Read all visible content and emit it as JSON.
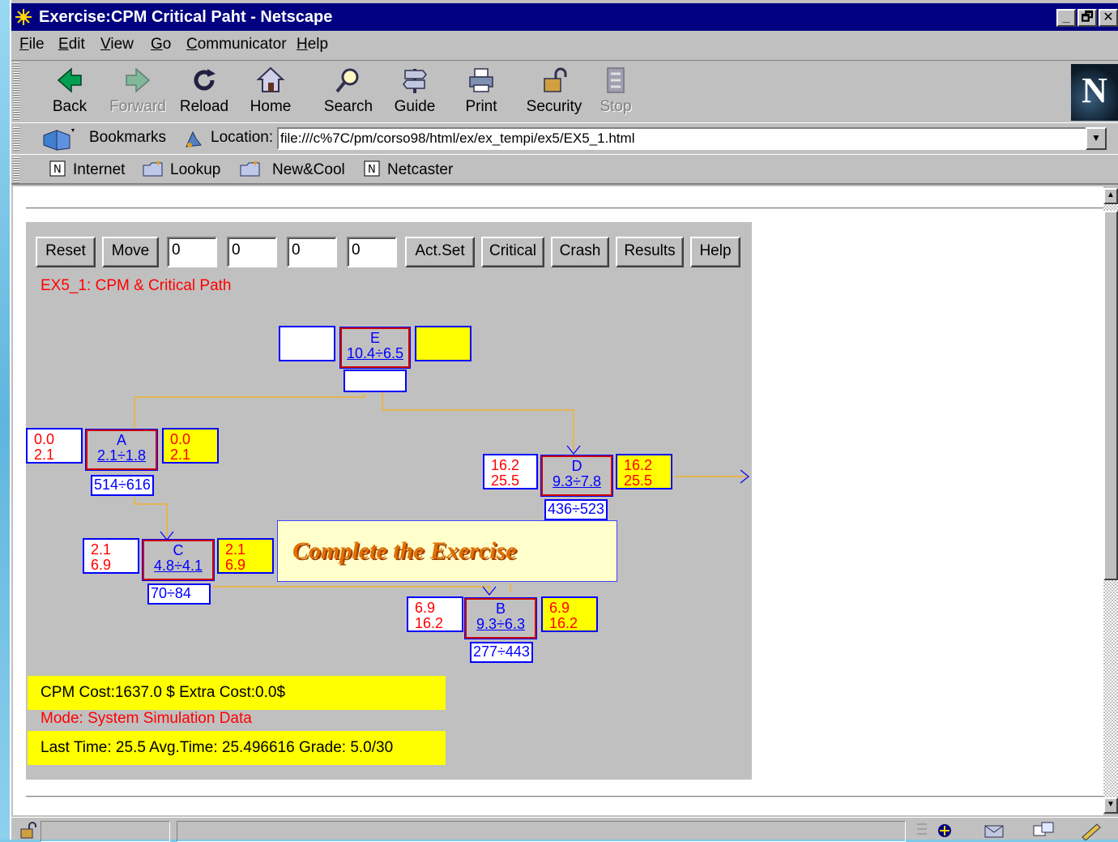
{
  "window": {
    "title": "Exercise:CPM Critical Paht - Netscape",
    "controls": [
      "_",
      "🗗",
      "✕"
    ]
  },
  "menu": [
    {
      "accel": "F",
      "rest": "ile"
    },
    {
      "accel": "E",
      "rest": "dit"
    },
    {
      "accel": "V",
      "rest": "iew"
    },
    {
      "accel": "G",
      "rest": "o"
    },
    {
      "accel": "C",
      "rest": "ommunicator"
    },
    {
      "accel": "H",
      "rest": "elp"
    }
  ],
  "toolbar": {
    "back": "Back",
    "forward": "Forward",
    "reload": "Reload",
    "home": "Home",
    "search": "Search",
    "guide": "Guide",
    "print": "Print",
    "security": "Security",
    "stop": "Stop",
    "logo": "N"
  },
  "location": {
    "bookmarks": "Bookmarks",
    "label": "Location:",
    "url": "file:///c%7C/pm/corso98/html/ex/ex_tempi/ex5/EX5_1.html"
  },
  "personal": {
    "internet": "Internet",
    "lookup": "Lookup",
    "newcool": "New&Cool",
    "netcaster": "Netcaster"
  },
  "applet": {
    "buttons": {
      "reset": "Reset",
      "move": "Move",
      "actset": "Act.Set",
      "critical": "Critical",
      "crash": "Crash",
      "results": "Results",
      "help": "Help"
    },
    "fields": [
      "0",
      "0",
      "0",
      "0"
    ],
    "exercise_title": "EX5_1: CPM & Critical Path",
    "popup": "Complete the Exercise",
    "nodes": {
      "E": {
        "name": "E",
        "duration": "10.4÷6.5",
        "early": [
          "",
          ""
        ],
        "late": [
          "",
          ""
        ],
        "cost": ""
      },
      "A": {
        "name": "A",
        "duration": "2.1÷1.8",
        "early": [
          "0.0",
          "2.1"
        ],
        "late": [
          "0.0",
          "2.1"
        ],
        "cost": "514÷616"
      },
      "D": {
        "name": "D",
        "duration": "9.3÷7.8",
        "early": [
          "16.2",
          "25.5"
        ],
        "late": [
          "16.2",
          "25.5"
        ],
        "cost": "436÷523"
      },
      "C": {
        "name": "C",
        "duration": "4.8÷4.1",
        "early": [
          "2.1",
          "6.9"
        ],
        "late": [
          "2.1",
          "6.9"
        ],
        "cost": "70÷84"
      },
      "B": {
        "name": "B",
        "duration": "9.3÷6.3",
        "early": [
          "6.9",
          "16.2"
        ],
        "late": [
          "6.9",
          "16.2"
        ],
        "cost": "277÷443"
      }
    },
    "cost_line": "CPM    Cost:1637.0 $  Extra Cost:0.0$",
    "mode_line": "Mode: System Simulation Data",
    "time_line": "Last Time: 25.5  Avg.Time: 25.496616    Grade:  5.0/30"
  },
  "colors": {
    "titlebar": "#000080",
    "chrome": "#c0c0c0",
    "highlight_yellow": "#ffff00",
    "arrow_orange": "#f0b030",
    "value_red": "#ff0000",
    "value_blue": "#0000ff"
  }
}
